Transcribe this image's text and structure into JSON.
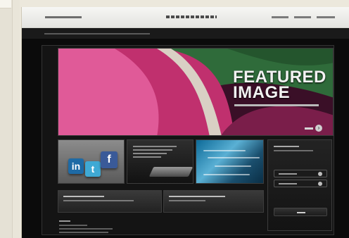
{
  "hero": {
    "title": "FEATURED\nIMAGE"
  },
  "social": {
    "linkedin_glyph": "in",
    "twitter_glyph": "t",
    "facebook_glyph": "f"
  },
  "icons": {
    "hero_more": "chevron-right-icon",
    "sidebar_option": "radio-dot-icon"
  },
  "colors": {
    "page_background": "#0b0b0b",
    "hero_magenta": "#c0306e",
    "hero_green": "#2f6b3a",
    "linkedin": "#1e6aa5",
    "twitter": "#3fa9d4",
    "facebook": "#3a5a98"
  }
}
